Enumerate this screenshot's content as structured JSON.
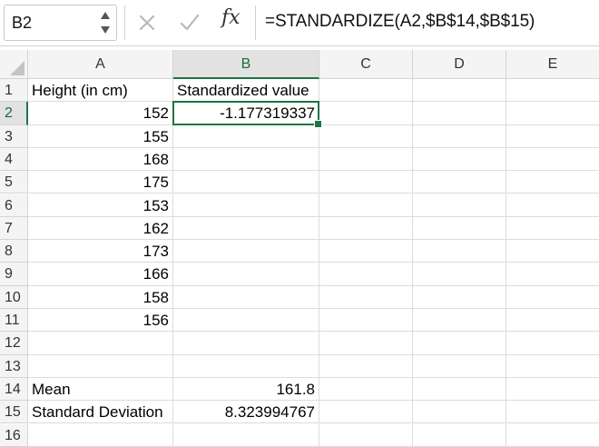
{
  "formula_bar": {
    "name_box": "B2",
    "cancel_icon": "close-x-icon",
    "enter_icon": "checkmark-icon",
    "function_label": "fx",
    "formula": "=STANDARDIZE(A2,$B$14,$B$15)"
  },
  "sheet": {
    "columns": [
      "A",
      "B",
      "C",
      "D",
      "E"
    ],
    "rows": [
      "1",
      "2",
      "3",
      "4",
      "5",
      "6",
      "7",
      "8",
      "9",
      "10",
      "11",
      "12",
      "13",
      "14",
      "15",
      "16"
    ],
    "active_cell": "B2",
    "accent_color": "#217346",
    "cells": {
      "A1": "Height (in cm)",
      "B1": "Standardized value",
      "A2": "152",
      "B2": "-1.177319337",
      "A3": "155",
      "A4": "168",
      "A5": "175",
      "A6": "153",
      "A7": "162",
      "A8": "173",
      "A9": "166",
      "A10": "158",
      "A11": "156",
      "A14": "Mean",
      "B14": "161.8",
      "A15": "Standard Deviation",
      "B15": "8.323994767"
    }
  }
}
